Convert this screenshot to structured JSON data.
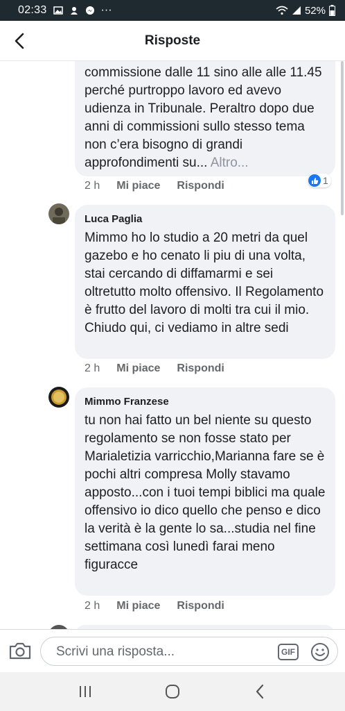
{
  "status_bar": {
    "time": "02:33",
    "more": "···",
    "battery": "52%"
  },
  "header": {
    "title": "Risposte"
  },
  "comments": [
    {
      "text": "commissione dalle 11 sino alle alle 11.45 perché purtroppo lavoro ed avevo udienza in Tribunale. Peraltro dopo due anni di commissioni  sullo stesso tema non c’era bisogno di grandi approfondimenti su...",
      "more_label": "Altro...",
      "time": "2 h",
      "like_label": "Mi piace",
      "reply_label": "Rispondi",
      "reaction_count": "1"
    },
    {
      "author": "Luca Paglia",
      "text": "Mimmo ho lo studio a 20 metri da quel gazebo e ho cenato li piu di una volta, stai cercando di diffamarmi e sei oltretutto molto offensivo. Il Regolamento è frutto del lavoro di molti tra cui il mio.  Chiudo qui, ci vediamo in altre sedi",
      "time": "2 h",
      "like_label": "Mi piace",
      "reply_label": "Rispondi"
    },
    {
      "author": "Mimmo Franzese",
      "text": "tu non hai fatto un bel niente su questo regolamento se non fosse stato per Marialetizia varricchio,Marianna fare se è pochi altri compresa Molly stavamo apposto...con i tuoi tempi biblici ma quale offensivo io dico quello che penso e dico la verità è la gente lo sa...studia nel fine settimana così lunedì farai meno figuracce",
      "time": "2 h",
      "like_label": "Mi piace",
      "reply_label": "Rispondi"
    }
  ],
  "composer": {
    "placeholder": "Scrivi una risposta...",
    "gif_label": "GIF"
  },
  "colors": {
    "status_bar": "#1f2a30",
    "bubble": "#f0f2f5",
    "like_blue": "#1877f2",
    "muted_text": "#65676b"
  }
}
